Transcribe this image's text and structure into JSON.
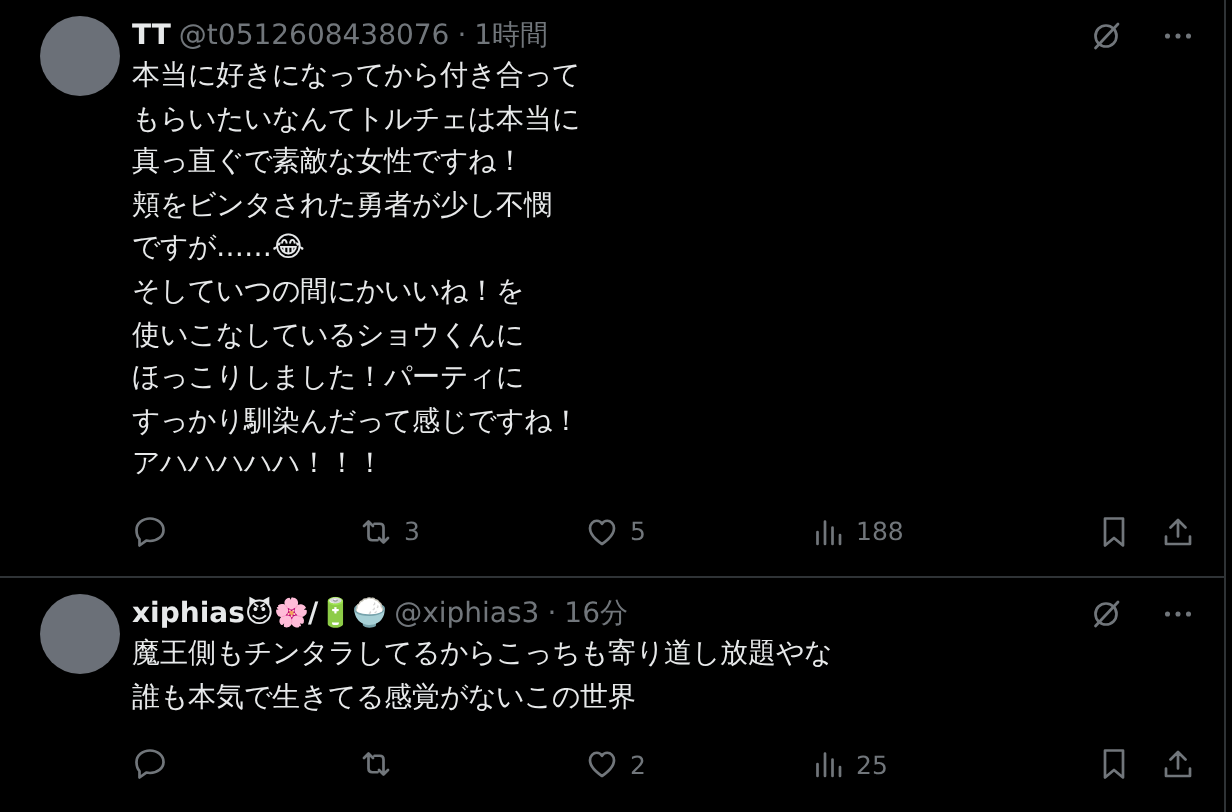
{
  "posts": [
    {
      "name": "TT",
      "handle": "@t0512608438076",
      "separator": "·",
      "time": "1時間",
      "lines": [
        "本当に好きになってから付き合って",
        "もらいたいなんてトルチェは本当に",
        "真っ直ぐで素敵な女性ですね！",
        "頬をビンタされた勇者が少し不憫",
        "ですが……😂",
        "そしていつの間にかいいね！を",
        "使いこなしているショウくんに",
        "ほっこりしました！パーティに",
        "すっかり馴染んだって感じですね！",
        "アハハハハハ！！！"
      ],
      "actions": [
        {
          "kind": "reply"
        },
        {
          "kind": "repost",
          "count": "3"
        },
        {
          "kind": "like",
          "count": "5"
        },
        {
          "kind": "views",
          "count": "188"
        }
      ]
    },
    {
      "name": "xiphias😈🌸/🔋🍚",
      "handle": "@xiphias3",
      "separator": "·",
      "time": "16分",
      "lines": [
        "魔王側もチンタラしてるからこっちも寄り道し放題やな",
        "誰も本気で生きてる感覚がないこの世界"
      ],
      "actions": [
        {
          "kind": "reply"
        },
        {
          "kind": "repost"
        },
        {
          "kind": "like",
          "count": "2"
        },
        {
          "kind": "views",
          "count": "25"
        }
      ]
    }
  ]
}
